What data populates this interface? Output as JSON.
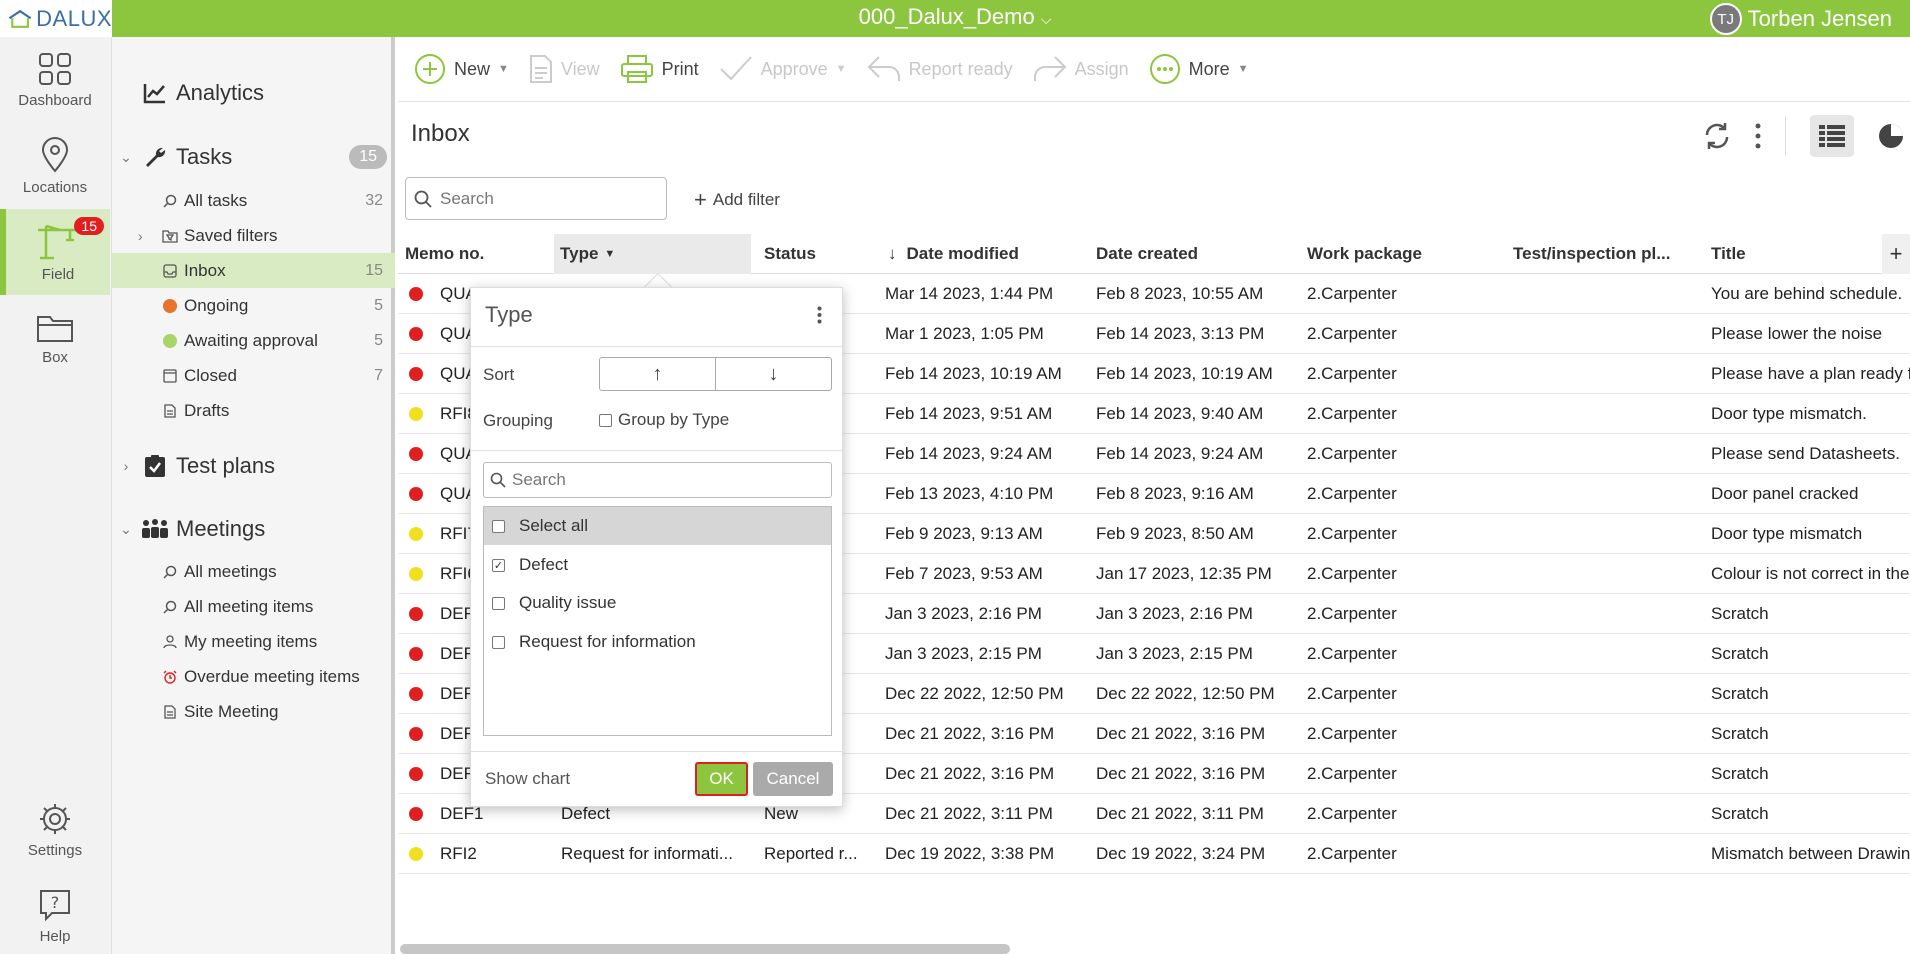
{
  "app": {
    "logo_text": "DALUX",
    "project": "000_Dalux_Demo",
    "user_initials": "TJ",
    "user_name": "Torben Jensen"
  },
  "rail": [
    {
      "label": "Dashboard",
      "icon": "dashboard-icon"
    },
    {
      "label": "Locations",
      "icon": "location-pin-icon"
    },
    {
      "label": "Field",
      "icon": "crane-icon",
      "badge": "15"
    },
    {
      "label": "Box",
      "icon": "folder-icon"
    },
    {
      "label": "Settings",
      "icon": "gear-icon"
    },
    {
      "label": "Help",
      "icon": "help-icon"
    }
  ],
  "nav": {
    "analytics": "Analytics",
    "tasks": {
      "label": "Tasks",
      "count": "15"
    },
    "task_items": [
      {
        "label": "All tasks",
        "count": "32"
      },
      {
        "label": "Saved filters",
        "count": ""
      },
      {
        "label": "Inbox",
        "count": "15"
      },
      {
        "label": "Ongoing",
        "count": "5",
        "color": "#e8732a"
      },
      {
        "label": "Awaiting approval",
        "count": "5",
        "color": "#a8d56a"
      },
      {
        "label": "Closed",
        "count": "7"
      },
      {
        "label": "Drafts",
        "count": ""
      }
    ],
    "test_plans": "Test plans",
    "meetings": "Meetings",
    "meeting_items": [
      {
        "label": "All meetings"
      },
      {
        "label": "All meeting items"
      },
      {
        "label": "My meeting items"
      },
      {
        "label": "Overdue meeting items"
      },
      {
        "label": "Site Meeting"
      }
    ]
  },
  "toolbar": {
    "new": "New",
    "view": "View",
    "print": "Print",
    "approve": "Approve",
    "report_ready": "Report ready",
    "assign": "Assign",
    "more": "More"
  },
  "inbox": {
    "title": "Inbox",
    "search_placeholder": "Search",
    "add_filter": "Add filter"
  },
  "table": {
    "headers": {
      "memo": "Memo no.",
      "type": "Type",
      "status": "Status",
      "modified": "Date modified",
      "created": "Date created",
      "work_package": "Work package",
      "test_plan": "Test/inspection pl...",
      "title": "Title"
    },
    "rows": [
      {
        "dot": "#e02020",
        "memo": "QUA",
        "type": "",
        "status": "",
        "modified": "Mar 14 2023, 1:44 PM",
        "created": "Feb 8 2023, 10:55 AM",
        "wp": "2.Carpenter",
        "title": "You are behind schedule."
      },
      {
        "dot": "#e02020",
        "memo": "QUA",
        "type": "",
        "status": "",
        "modified": "Mar 1 2023, 1:05 PM",
        "created": "Feb 14 2023, 3:13 PM",
        "wp": "2.Carpenter",
        "title": "Please lower the noise"
      },
      {
        "dot": "#e02020",
        "memo": "QUA",
        "type": "",
        "status": "",
        "modified": "Feb 14 2023, 10:19 AM",
        "created": "Feb 14 2023, 10:19 AM",
        "wp": "2.Carpenter",
        "title": "Please have a plan ready f"
      },
      {
        "dot": "#f0e020",
        "memo": "RFI8",
        "type": "",
        "status": "r...",
        "modified": "Feb 14 2023, 9:51 AM",
        "created": "Feb 14 2023, 9:40 AM",
        "wp": "2.Carpenter",
        "title": "Door type mismatch."
      },
      {
        "dot": "#e02020",
        "memo": "QUA",
        "type": "",
        "status": "",
        "modified": "Feb 14 2023, 9:24 AM",
        "created": "Feb 14 2023, 9:24 AM",
        "wp": "2.Carpenter",
        "title": "Please send Datasheets."
      },
      {
        "dot": "#e02020",
        "memo": "QUA",
        "type": "",
        "status": "",
        "modified": "Feb 13 2023, 4:10 PM",
        "created": "Feb 8 2023, 9:16 AM",
        "wp": "2.Carpenter",
        "title": "Door panel cracked"
      },
      {
        "dot": "#f0e020",
        "memo": "RFI7",
        "type": "",
        "status": "r...",
        "modified": "Feb 9 2023, 9:13 AM",
        "created": "Feb 9 2023, 8:50 AM",
        "wp": "2.Carpenter",
        "title": "Door type mismatch"
      },
      {
        "dot": "#f0e020",
        "memo": "RFI6",
        "type": "",
        "status": "r...",
        "modified": "Feb 7 2023, 9:53 AM",
        "created": "Jan 17 2023, 12:35 PM",
        "wp": "2.Carpenter",
        "title": "Colour is not correct in the"
      },
      {
        "dot": "#e02020",
        "memo": "DEF",
        "type": "",
        "status": "",
        "modified": "Jan 3 2023, 2:16 PM",
        "created": "Jan 3 2023, 2:16 PM",
        "wp": "2.Carpenter",
        "title": "Scratch"
      },
      {
        "dot": "#e02020",
        "memo": "DEF",
        "type": "",
        "status": "",
        "modified": "Jan 3 2023, 2:15 PM",
        "created": "Jan 3 2023, 2:15 PM",
        "wp": "2.Carpenter",
        "title": "Scratch"
      },
      {
        "dot": "#e02020",
        "memo": "DEF",
        "type": "",
        "status": "",
        "modified": "Dec 22 2022, 12:50 PM",
        "created": "Dec 22 2022, 12:50 PM",
        "wp": "2.Carpenter",
        "title": "Scratch"
      },
      {
        "dot": "#e02020",
        "memo": "DEF",
        "type": "",
        "status": "",
        "modified": "Dec 21 2022, 3:16 PM",
        "created": "Dec 21 2022, 3:16 PM",
        "wp": "2.Carpenter",
        "title": "Scratch"
      },
      {
        "dot": "#e02020",
        "memo": "DEF",
        "type": "",
        "status": "",
        "modified": "Dec 21 2022, 3:16 PM",
        "created": "Dec 21 2022, 3:16 PM",
        "wp": "2.Carpenter",
        "title": "Scratch"
      },
      {
        "dot": "#e02020",
        "memo": "DEF1",
        "type": "Defect",
        "status": "New",
        "modified": "Dec 21 2022, 3:11 PM",
        "created": "Dec 21 2022, 3:11 PM",
        "wp": "2.Carpenter",
        "title": "Scratch"
      },
      {
        "dot": "#f0e020",
        "memo": "RFI2",
        "type": "Request for informati...",
        "status": "Reported r...",
        "modified": "Dec 19 2022, 3:38 PM",
        "created": "Dec 19 2022, 3:24 PM",
        "wp": "2.Carpenter",
        "title": "Mismatch between Drawin"
      }
    ]
  },
  "popup": {
    "title": "Type",
    "sort_label": "Sort",
    "grouping_label": "Grouping",
    "group_by": "Group by Type",
    "search_placeholder": "Search",
    "options": [
      {
        "label": "Select all",
        "checked": false
      },
      {
        "label": "Defect",
        "checked": true
      },
      {
        "label": "Quality issue",
        "checked": false
      },
      {
        "label": "Request for information",
        "checked": false
      }
    ],
    "show_chart": "Show chart",
    "ok": "OK",
    "cancel": "Cancel"
  }
}
